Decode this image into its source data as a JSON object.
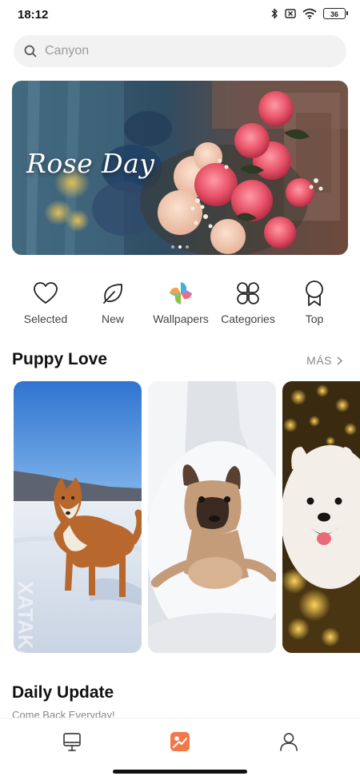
{
  "status_bar": {
    "time": "18:12",
    "battery": "36",
    "icons": [
      "bluetooth-icon",
      "no-sim-icon",
      "wifi-icon",
      "battery-icon"
    ]
  },
  "search": {
    "placeholder": "Canyon",
    "icon": "search-icon"
  },
  "banner": {
    "title": "Rose Day",
    "slides": 3,
    "active_slide": 2
  },
  "categories": [
    {
      "label": "Selected",
      "icon": "heart-icon"
    },
    {
      "label": "New",
      "icon": "leaf-icon"
    },
    {
      "label": "Wallpapers",
      "icon": "pinwheel-icon"
    },
    {
      "label": "Categories",
      "icon": "four-petal-icon"
    },
    {
      "label": "Top",
      "icon": "award-ribbon-icon"
    }
  ],
  "section": {
    "title": "Puppy Love",
    "more_label": "MÁS"
  },
  "cards": [
    {
      "subject": "husky-in-snow",
      "watermark": "XATAKA"
    },
    {
      "subject": "french-bulldog"
    },
    {
      "subject": "samoyed-with-bokeh"
    }
  ],
  "daily": {
    "title": "Daily Update",
    "subtitle": "Come Back Everyday!"
  },
  "bottom_nav": [
    {
      "name": "discover",
      "icon": "easel-icon",
      "active": false
    },
    {
      "name": "wallpapers",
      "icon": "image-icon",
      "active": true
    },
    {
      "name": "profile",
      "icon": "person-icon",
      "active": false
    }
  ],
  "colors": {
    "accent": "#f2784b",
    "text": "#111111",
    "muted": "#888888"
  }
}
